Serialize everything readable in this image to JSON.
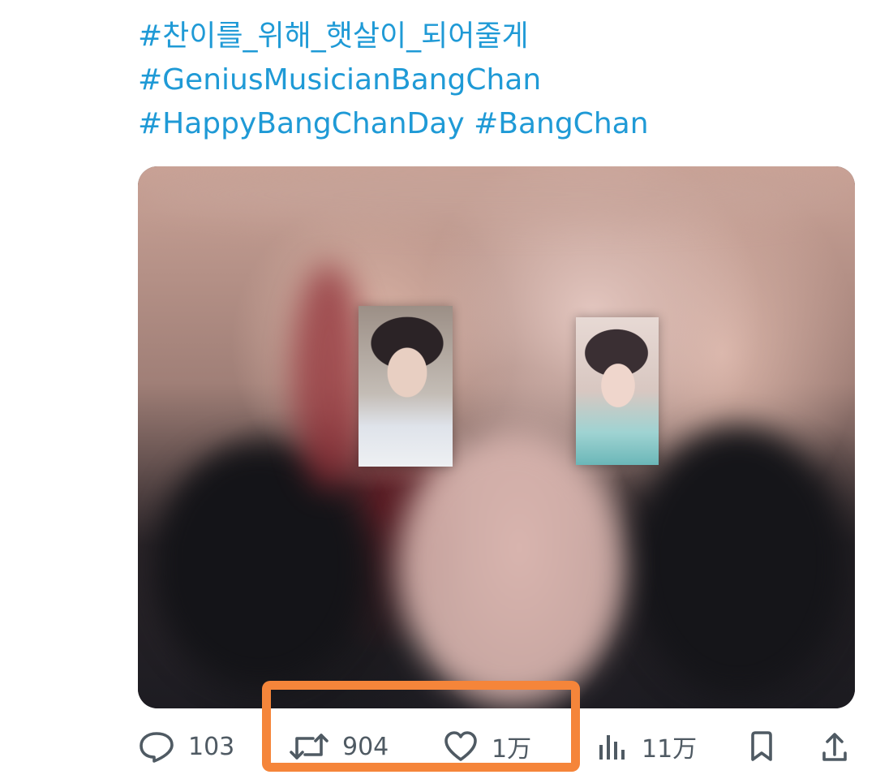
{
  "tweet": {
    "hashtags": [
      "#찬이를_위해_햇살이_되어줄게",
      "#GeniusMusicianBangChan",
      "#HappyBangChanDay #BangChan"
    ],
    "media": {
      "description_icon": "photo"
    }
  },
  "actions": {
    "reply": {
      "icon": "reply-icon",
      "count": "103"
    },
    "retweet": {
      "icon": "retweet-icon",
      "count": "904"
    },
    "like": {
      "icon": "heart-icon",
      "count": "1万"
    },
    "views": {
      "icon": "analytics-icon",
      "count": "11万"
    },
    "bookmark": {
      "icon": "bookmark-icon"
    },
    "share": {
      "icon": "share-icon"
    }
  },
  "colors": {
    "hashtag": "#1f9ad6",
    "highlight": "#f5853a",
    "action": "#4f5a63"
  }
}
